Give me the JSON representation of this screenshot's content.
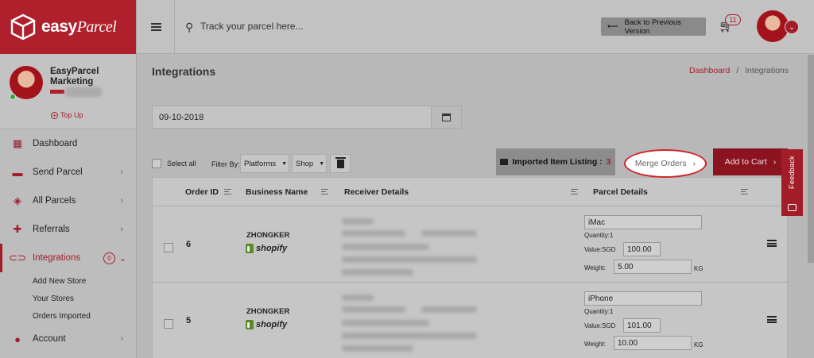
{
  "brand": {
    "logo_text": "easy",
    "logo_italic": "Parcel"
  },
  "profile": {
    "name": "EasyParcel Marketing",
    "topup_label": "Top Up"
  },
  "sidebar": {
    "items": [
      {
        "label": "Dashboard",
        "icon": "dashboard-icon"
      },
      {
        "label": "Send Parcel",
        "icon": "truck-icon"
      },
      {
        "label": "All Parcels",
        "icon": "parcels-icon"
      },
      {
        "label": "Referrals",
        "icon": "referral-icon"
      },
      {
        "label": "Integrations",
        "icon": "link-icon",
        "badge": "0"
      },
      {
        "label": "Account",
        "icon": "user-icon"
      }
    ],
    "subitems": [
      "Add New Store",
      "Your Stores",
      "Orders Imported"
    ]
  },
  "header": {
    "search_placeholder": "Track your parcel here...",
    "back_label": "Back to Previous Version",
    "cart_count": "11"
  },
  "page": {
    "title": "Integrations",
    "breadcrumb": {
      "home": "Dashboard",
      "sep": "/",
      "current": "Integrations"
    },
    "date_value": "09-10-2018"
  },
  "toolbar": {
    "select_all": "Select all",
    "filter_by": "Filter By:",
    "platforms": "Platforms",
    "shop": "Shop",
    "imported_label": "Imported Item Listing :",
    "imported_count": "3",
    "merge_label": "Merge Orders",
    "add_cart_label": "Add to Cart",
    "feedback_label": "Feedback"
  },
  "table": {
    "columns": [
      "Order ID",
      "Business Name",
      "Receiver Details",
      "Parcel Details"
    ],
    "rows": [
      {
        "order_id": "6",
        "business": "ZHONGKER",
        "platform": "shopify",
        "item": "iMac",
        "quantity_label": "Quantity:",
        "quantity": "1",
        "value_label": "Value:SGD",
        "value": "100.00",
        "weight_label": "Weight:",
        "weight": "5.00",
        "unit": "KG"
      },
      {
        "order_id": "5",
        "business": "ZHONGKER",
        "platform": "shopify",
        "item": "iPhone",
        "quantity_label": "Quantity:",
        "quantity": "1",
        "value_label": "Value:SGD",
        "value": "101.00",
        "weight_label": "Weight:",
        "weight": "10.00",
        "unit": "KG"
      }
    ]
  }
}
